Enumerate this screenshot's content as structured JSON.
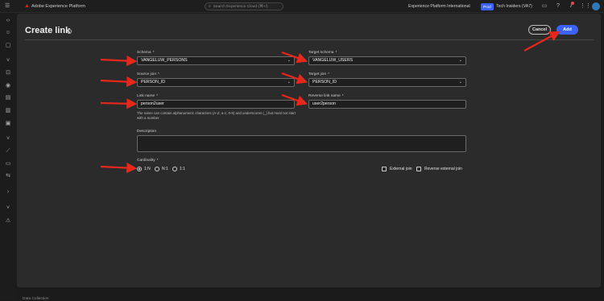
{
  "topbar": {
    "product_name": "Adobe Experience Platform",
    "search_placeholder": "Search Experience Cloud (⌘+/)",
    "org_name": "Experience Platform International",
    "env_badge": "Prod",
    "sandbox_name": "Tech Insiders (VA7)",
    "icons": [
      "menu-icon",
      "adobe-logo",
      "search-icon",
      "chat-icon",
      "help-icon",
      "bell-icon",
      "apps-grid-icon",
      "avatar"
    ]
  },
  "leftrail": {
    "icons": [
      "nav-icon-1",
      "nav-icon-2",
      "nav-icon-3",
      "nav-icon-4",
      "nav-icon-5",
      "nav-icon-6",
      "nav-icon-7",
      "nav-icon-8",
      "nav-icon-9",
      "nav-icon-10",
      "nav-icon-11",
      "nav-icon-12",
      "nav-icon-13",
      "nav-icon-14",
      "nav-icon-15",
      "nav-icon-16"
    ]
  },
  "dialog": {
    "title": "Create link",
    "cancel_label": "Cancel",
    "add_label": "Add",
    "schema": {
      "label": "Schema",
      "value": "VANGELUW_PERSONS"
    },
    "target_schema": {
      "label": "Target schema",
      "value": "VANGELUW_USERS"
    },
    "source_join": {
      "label": "Source join",
      "value": "PERSON_ID"
    },
    "target_join": {
      "label": "Target join",
      "value": "PERSON_ID"
    },
    "link_name": {
      "label": "Link name",
      "value": "person2user"
    },
    "reverse_link_name": {
      "label": "Reverse link name",
      "value": "user2person"
    },
    "help_text": "The name can contain alphanumeric characters (A-Z, a-z, 0-9) and underscores (_) but must not start with a number.",
    "description": {
      "label": "Description",
      "value": ""
    },
    "cardinality": {
      "label": "Cardinality",
      "options": [
        "1:N",
        "N:1",
        "1:1"
      ],
      "selected": "1:N"
    },
    "external_join_label": "External join",
    "reverse_external_join_label": "Reverse external join",
    "required_marker": "*"
  },
  "bottombar": {
    "text": "Data Collection"
  },
  "colors": {
    "accent": "#3b63fb",
    "annotation_arrow": "#e8271b",
    "background": "#1b1b1b",
    "dialog": "#2b2b2b"
  }
}
